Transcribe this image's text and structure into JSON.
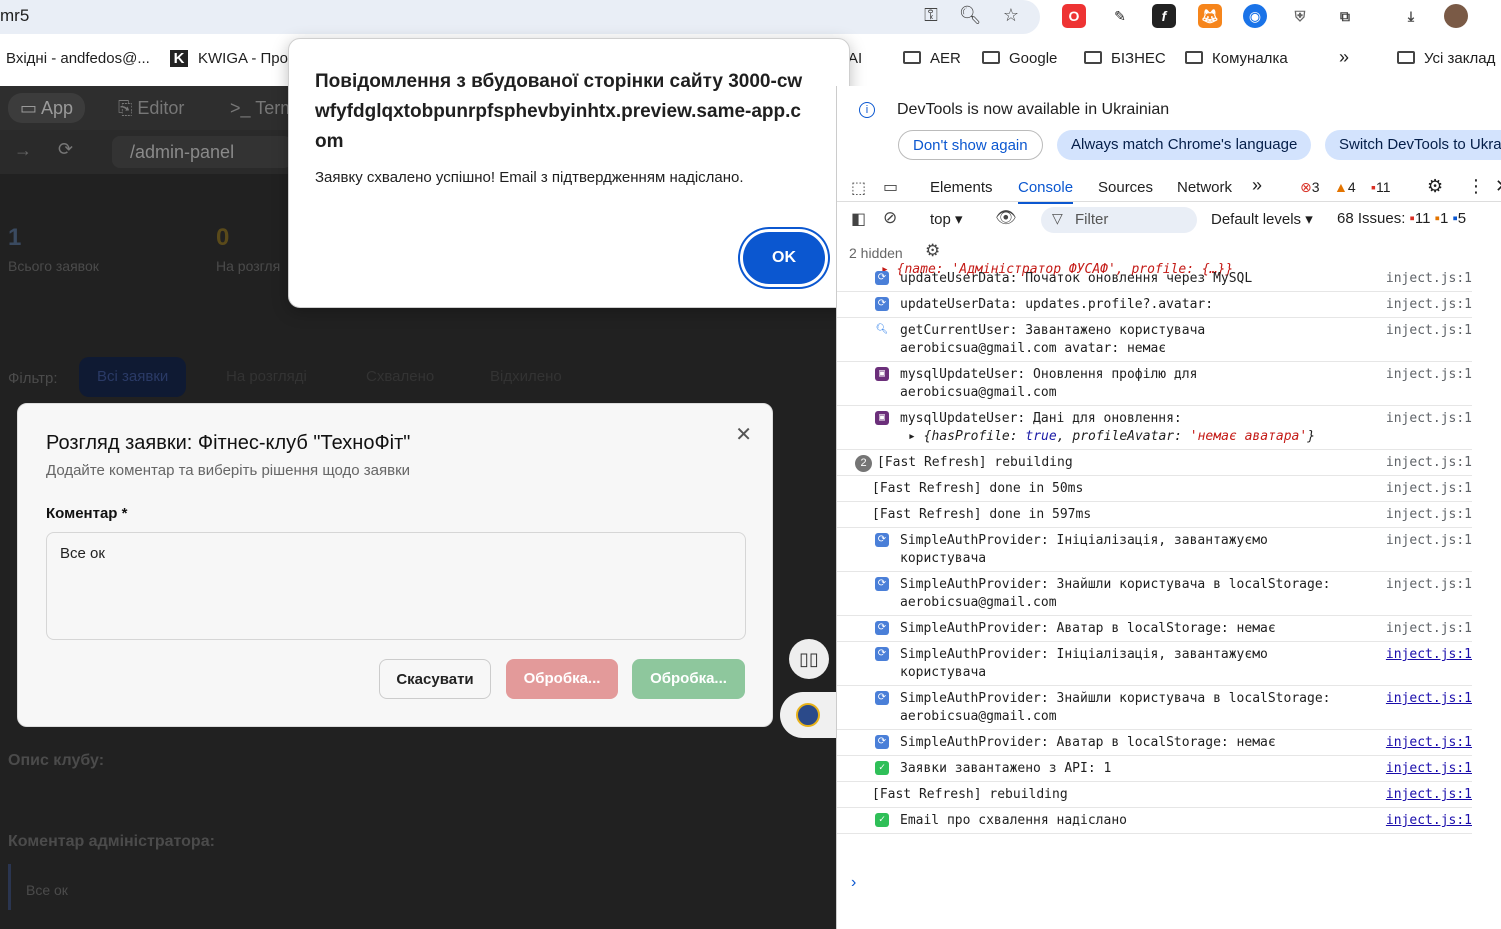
{
  "browser": {
    "url": "mr5",
    "bookmarks": [
      "Вхідні - andfedos@...",
      "KWIGA - Про",
      "AI",
      "AER",
      "Google",
      "БІЗНЕС",
      "Комуналка",
      "Усі заклад"
    ]
  },
  "app": {
    "tabs": [
      "App",
      "Editor",
      "Term"
    ],
    "url_path": "/admin-panel",
    "stats": [
      {
        "value": "1",
        "label": "Всього заявок"
      },
      {
        "value": "0",
        "label": "На розгля"
      }
    ],
    "filter_label": "Фільтр:",
    "filters": [
      "Всі заявки",
      "На розгляді",
      "Схвалено",
      "Відхилено"
    ],
    "club_desc_label": "Опис клубу:",
    "admin_comment_label": "Коментар адміністратора:",
    "admin_comment": "Все ок"
  },
  "modal": {
    "title": "Розгляд заявки: Фітнес-клуб \"ТехноФіт\"",
    "subtitle": "Додайте коментар та виберіть рішення щодо заявки",
    "comment_label": "Коментар *",
    "comment_value": "Все ок",
    "cancel": "Скасувати",
    "reject": "Обробка...",
    "approve": "Обробка..."
  },
  "alert": {
    "title": "Повідомлення з вбудованої сторінки сайту 3000-cwwfyfdglqxtobpunrpfsphevbyinhtx.preview.same-app.com",
    "message": "Заявку схвалено успішно! Email з підтвердженням надіслано.",
    "ok": "OK"
  },
  "devtools": {
    "banner_text": "DevTools is now available in Ukrainian",
    "dont_show": "Don't show again",
    "always_match": "Always match Chrome's language",
    "switch": "Switch DevTools to Ukra",
    "tabs": [
      "Elements",
      "Console",
      "Sources",
      "Network"
    ],
    "errors": "3",
    "warnings": "4",
    "issues_top": "11",
    "context": "top",
    "filter_placeholder": "Filter",
    "levels": "Default levels",
    "issues_label": "68 Issues:",
    "issues_err": "11",
    "issues_warn": "1",
    "issues_info": "5",
    "hidden": "2 hidden",
    "logs": [
      {
        "icon": "refresh",
        "text": "updateUserData: Початок оновлення через MySQL",
        "src": "inject.js:1"
      },
      {
        "icon": "refresh",
        "text": "updateUserData: updates.profile?.avatar:",
        "src": "inject.js:1"
      },
      {
        "icon": "search",
        "text": "getCurrentUser: Завантажено користувача\naerobicsua@gmail.com avatar: немає",
        "src": "inject.js:1"
      },
      {
        "icon": "disk",
        "text": "mysqlUpdateUser: Оновлення профілю для\naerobicsua@gmail.com",
        "src": "inject.js:1"
      },
      {
        "icon": "disk",
        "text": "mysqlUpdateUser: Дані для оновлення:",
        "src": "inject.js:1"
      },
      {
        "icon": "",
        "text": "[Fast Refresh] rebuilding",
        "src": "inject.js:1",
        "count": "2"
      },
      {
        "icon": "",
        "text": "[Fast Refresh] done in 50ms",
        "src": "inject.js:1"
      },
      {
        "icon": "",
        "text": "[Fast Refresh] done in 597ms",
        "src": "inject.js:1"
      },
      {
        "icon": "refresh",
        "text": "SimpleAuthProvider: Ініціалізація, завантажуємо\nкористувача",
        "src": "inject.js:1"
      },
      {
        "icon": "refresh",
        "text": "SimpleAuthProvider: Знайшли користувача в localStorage:\naerobicsua@gmail.com",
        "src": "inject.js:1"
      },
      {
        "icon": "refresh",
        "text": "SimpleAuthProvider: Аватар в localStorage: немає",
        "src": "inject.js:1"
      },
      {
        "icon": "refresh",
        "text": "SimpleAuthProvider: Ініціалізація, завантажуємо\nкористувача",
        "src": "inject.js:1",
        "link": true
      },
      {
        "icon": "refresh",
        "text": "SimpleAuthProvider: Знайшли користувача в localStorage:\naerobicsua@gmail.com",
        "src": "inject.js:1",
        "link": true
      },
      {
        "icon": "refresh",
        "text": "SimpleAuthProvider: Аватар в localStorage: немає",
        "src": "inject.js:1",
        "link": true
      },
      {
        "icon": "check",
        "text": "Заявки завантажено з API: 1",
        "src": "inject.js:1",
        "link": true
      },
      {
        "icon": "",
        "text": "[Fast Refresh] rebuilding",
        "src": "inject.js:1",
        "link": true
      },
      {
        "icon": "check",
        "text": "Email про схвалення надіслано",
        "src": "inject.js:1",
        "link": true
      }
    ],
    "obj_top": "{name: 'Адміністратор ФУСАФ', profile: {…}}",
    "obj_hasProfile": "{hasProfile: true, profileAvatar: 'немає аватара'}"
  }
}
